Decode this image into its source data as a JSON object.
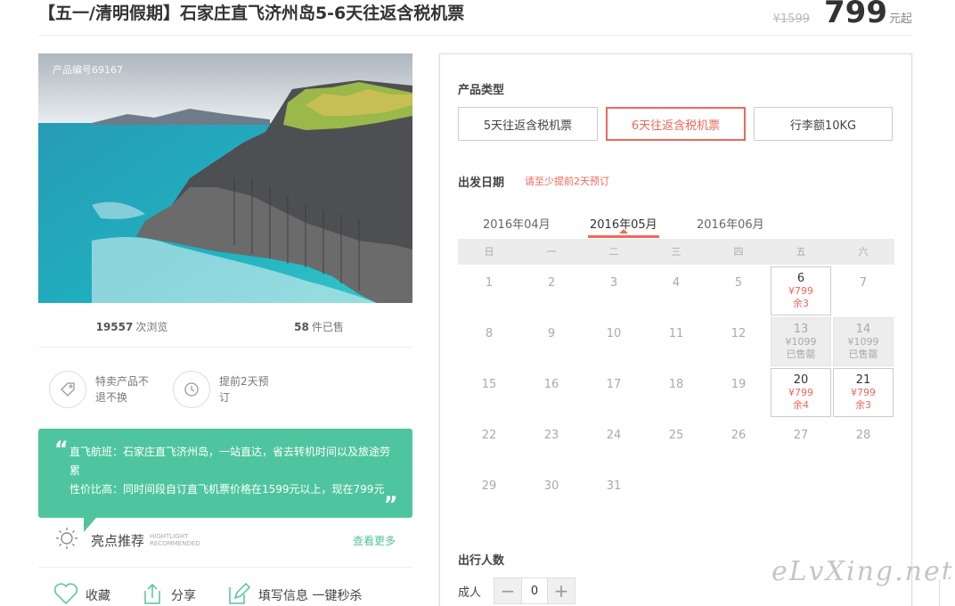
{
  "header": {
    "title": "【五一/清明假期】石家庄直飞济州岛5-6天往返含税机票",
    "original_price": "¥1599",
    "price": "799",
    "price_unit": "元起"
  },
  "photo": {
    "product_no": "产品编号69167"
  },
  "stats": {
    "views_count": "19557",
    "views_label": "次浏览",
    "sold_count": "58",
    "sold_label": "件已售"
  },
  "features": [
    {
      "icon": "tag-icon",
      "label": "特卖产品不退不换"
    },
    {
      "icon": "clock-icon",
      "label": "提前2天预订"
    }
  ],
  "quote": {
    "open": "“",
    "line1": "直飞航班：石家庄直飞济州岛，一站直达，省去转机时间以及旅途劳累",
    "line2": "性价比高：同时间段自订直飞机票价格在1599元以上，现在799元",
    "close": "„"
  },
  "highlight": {
    "title": "亮点推荐",
    "en_line1": "HIGHTLIGHT",
    "en_line2": "RECOMMENDED",
    "more": "查看更多"
  },
  "actions": {
    "favorite": "收藏",
    "share": "分享",
    "fill_info": "填写信息 一键秒杀"
  },
  "booking": {
    "product_type_label": "产品类型",
    "options": [
      "5天往返含税机票",
      "6天往返含税机票",
      "行李额10KG"
    ],
    "selected_option": 1,
    "depart_label": "出发日期",
    "depart_hint": "请至少提前2天预订",
    "months": [
      "2016年04月",
      "2016年05月",
      "2016年06月"
    ],
    "active_month": 1,
    "weekdays": [
      "日",
      "一",
      "二",
      "三",
      "四",
      "五",
      "六"
    ],
    "weeks": [
      [
        {
          "d": "1"
        },
        {
          "d": "2"
        },
        {
          "d": "3"
        },
        {
          "d": "4"
        },
        {
          "d": "5"
        },
        {
          "d": "6",
          "price": "¥799",
          "status": "余3",
          "state": "avail"
        },
        {
          "d": "7"
        }
      ],
      [
        {
          "d": "8"
        },
        {
          "d": "9"
        },
        {
          "d": "10"
        },
        {
          "d": "11"
        },
        {
          "d": "12"
        },
        {
          "d": "13",
          "price": "¥1099",
          "status": "已售罄",
          "state": "sold"
        },
        {
          "d": "14",
          "price": "¥1099",
          "status": "已售罄",
          "state": "sold"
        }
      ],
      [
        {
          "d": "15"
        },
        {
          "d": "16"
        },
        {
          "d": "17"
        },
        {
          "d": "18"
        },
        {
          "d": "19"
        },
        {
          "d": "20",
          "price": "¥799",
          "status": "余4",
          "state": "avail"
        },
        {
          "d": "21",
          "price": "¥799",
          "status": "余3",
          "state": "avail"
        }
      ],
      [
        {
          "d": "22"
        },
        {
          "d": "23"
        },
        {
          "d": "24"
        },
        {
          "d": "25"
        },
        {
          "d": "26"
        },
        {
          "d": "27"
        },
        {
          "d": "28"
        }
      ],
      [
        {
          "d": "29"
        },
        {
          "d": "30"
        },
        {
          "d": "31"
        },
        {
          "d": ""
        },
        {
          "d": ""
        },
        {
          "d": ""
        },
        {
          "d": ""
        }
      ]
    ],
    "people_label": "出行人数",
    "adult_label": "成人",
    "adult_count": "0",
    "minus": "−",
    "plus": "+"
  },
  "watermark": "eLvXing.net",
  "colors": {
    "accent_red": "#f0685a",
    "accent_green": "#4ec59e"
  }
}
